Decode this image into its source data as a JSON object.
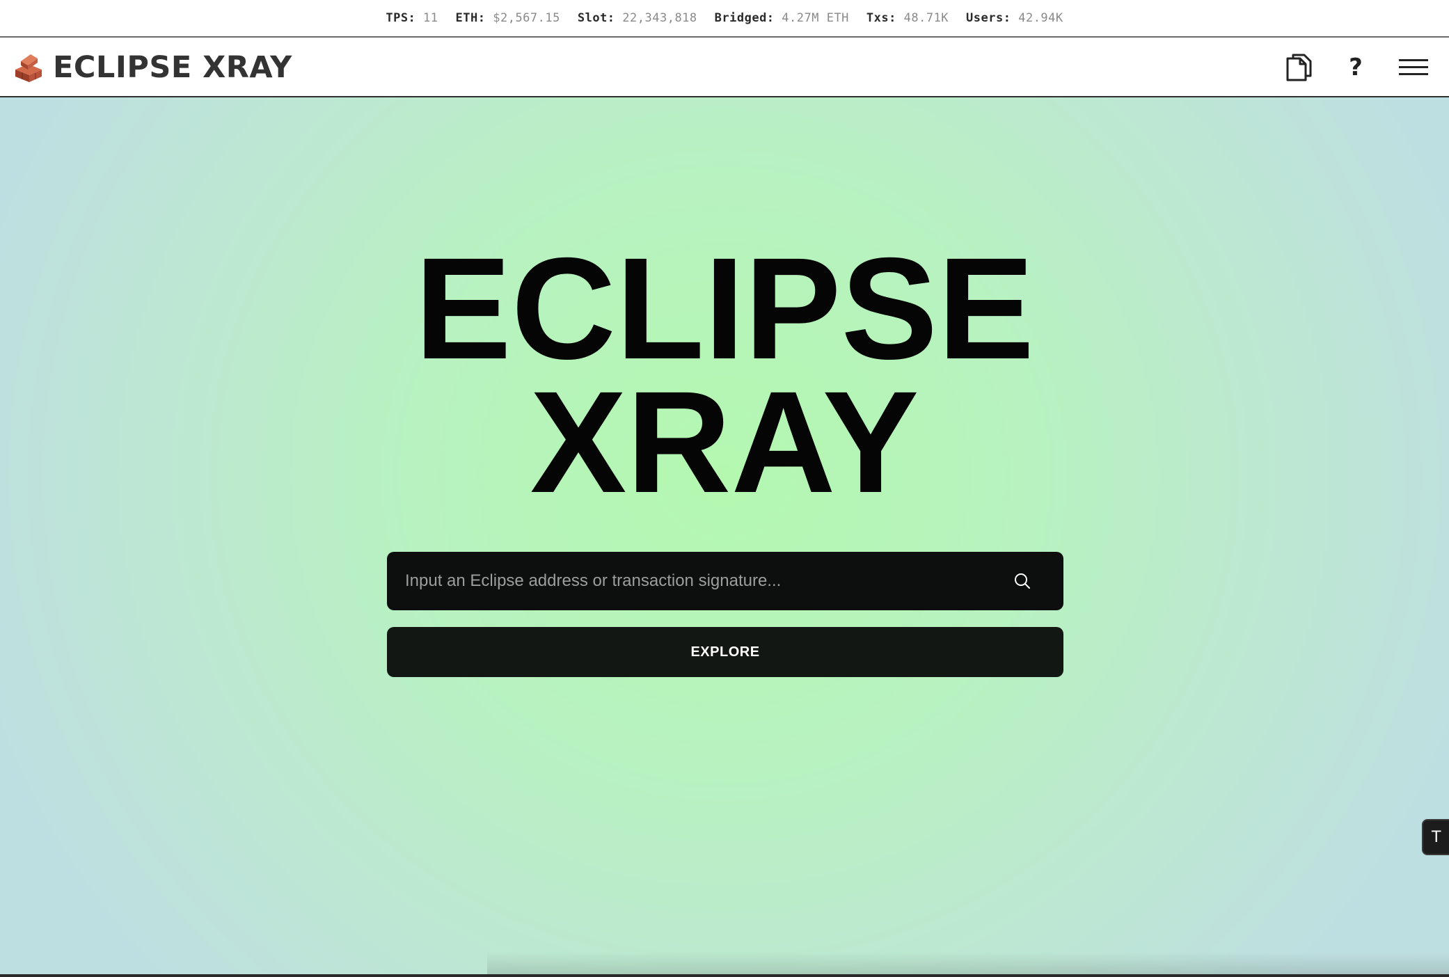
{
  "stats": [
    {
      "label": "TPS:",
      "value": "11"
    },
    {
      "label": "ETH:",
      "value": "$2,567.15"
    },
    {
      "label": "Slot:",
      "value": "22,343,818"
    },
    {
      "label": "Bridged:",
      "value": "4.27M ETH"
    },
    {
      "label": "Txs:",
      "value": "48.71K"
    },
    {
      "label": "Users:",
      "value": "42.94K"
    }
  ],
  "header": {
    "brand_name": "ECLIPSE XRAY",
    "logo_icon": "brick-box-icon",
    "actions": [
      {
        "icon": "docs-icon"
      },
      {
        "icon": "help-icon",
        "glyph": "?"
      },
      {
        "icon": "menu-icon"
      }
    ]
  },
  "hero": {
    "title_line1": "ECLIPSE",
    "title_line2": "XRAY",
    "search": {
      "placeholder": "Input an Eclipse address or transaction signature...",
      "value": "",
      "icon": "search-icon"
    },
    "explore_label": "EXPLORE"
  },
  "corner_widget": {
    "label": "T"
  },
  "colors": {
    "hero_center": "#b4f8b0",
    "hero_edge": "#bedfe1",
    "search_bg": "#0c0f0d",
    "button_bg": "#121714",
    "brand_text": "#333333",
    "stat_value": "#8a8a8a"
  }
}
